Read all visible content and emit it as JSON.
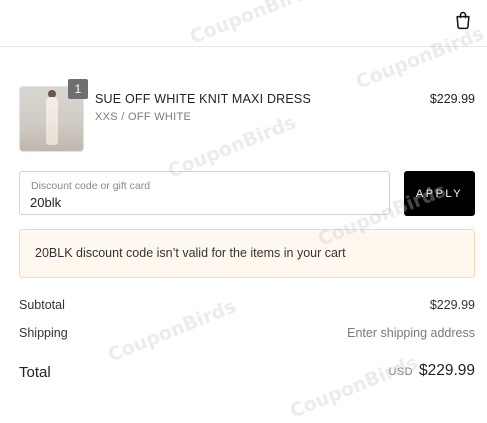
{
  "header": {
    "bag_icon": "shopping-bag-icon"
  },
  "line_item": {
    "quantity": "1",
    "title": "SUE OFF WHITE KNIT MAXI DRESS",
    "variant": "XXS / OFF WHITE",
    "price": "$229.99"
  },
  "discount": {
    "label": "Discount code or gift card",
    "value": "20blk",
    "apply_label": "APPLY"
  },
  "error": {
    "message": "20BLK discount code isn’t valid for the items in your cart"
  },
  "summary": {
    "subtotal_label": "Subtotal",
    "subtotal_value": "$229.99",
    "shipping_label": "Shipping",
    "shipping_value": "Enter shipping address",
    "total_label": "Total",
    "currency": "USD",
    "total_value": "$229.99"
  },
  "watermark": {
    "text": "CouponBirds"
  },
  "colors": {
    "apply_button_bg": "#000000",
    "error_banner_bg": "#fff8ef",
    "error_banner_border": "#f2dcb7",
    "qty_badge_bg": "#6f6f6f"
  }
}
